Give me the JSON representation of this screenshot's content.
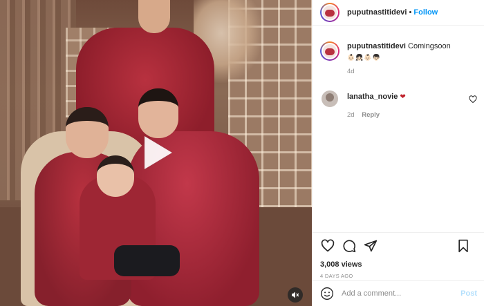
{
  "header": {
    "username": "puputnastitidevi",
    "separator": "•",
    "follow_label": "Follow"
  },
  "media": {
    "type": "video",
    "play_icon": "play-icon",
    "mute_icon": "speaker-muted-icon"
  },
  "caption": {
    "username": "puputnastitidevi",
    "text": "Comingsoon",
    "emojis": "👶🏻👧🏻👶🏻👦🏻",
    "age": "4d"
  },
  "comments": [
    {
      "username": "lanatha_novie",
      "text": "❤",
      "age": "2d",
      "reply_label": "Reply"
    }
  ],
  "actions": {
    "like_icon": "heart-outline-icon",
    "comment_icon": "comment-bubble-icon",
    "share_icon": "paper-plane-icon",
    "save_icon": "bookmark-icon",
    "views": "3,008 views",
    "date": "4 DAYS AGO"
  },
  "add_comment": {
    "emoji_icon": "smiley-icon",
    "placeholder": "Add a comment...",
    "post_label": "Post"
  },
  "colors": {
    "follow": "#0095f6",
    "heart": "#c0212b",
    "post_disabled": "#b2dffc",
    "muted_text": "#8e8e8e"
  }
}
